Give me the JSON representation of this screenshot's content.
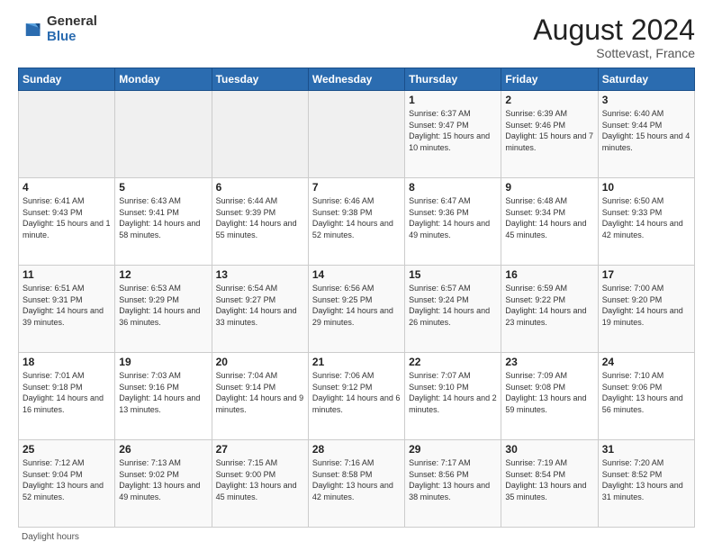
{
  "logo": {
    "general": "General",
    "blue": "Blue"
  },
  "title": "August 2024",
  "location": "Sottevast, France",
  "days_of_week": [
    "Sunday",
    "Monday",
    "Tuesday",
    "Wednesday",
    "Thursday",
    "Friday",
    "Saturday"
  ],
  "footer_text": "Daylight hours",
  "weeks": [
    [
      {
        "day": "",
        "sunrise": "",
        "sunset": "",
        "daylight": ""
      },
      {
        "day": "",
        "sunrise": "",
        "sunset": "",
        "daylight": ""
      },
      {
        "day": "",
        "sunrise": "",
        "sunset": "",
        "daylight": ""
      },
      {
        "day": "",
        "sunrise": "",
        "sunset": "",
        "daylight": ""
      },
      {
        "day": "1",
        "sunrise": "Sunrise: 6:37 AM",
        "sunset": "Sunset: 9:47 PM",
        "daylight": "Daylight: 15 hours and 10 minutes."
      },
      {
        "day": "2",
        "sunrise": "Sunrise: 6:39 AM",
        "sunset": "Sunset: 9:46 PM",
        "daylight": "Daylight: 15 hours and 7 minutes."
      },
      {
        "day": "3",
        "sunrise": "Sunrise: 6:40 AM",
        "sunset": "Sunset: 9:44 PM",
        "daylight": "Daylight: 15 hours and 4 minutes."
      }
    ],
    [
      {
        "day": "4",
        "sunrise": "Sunrise: 6:41 AM",
        "sunset": "Sunset: 9:43 PM",
        "daylight": "Daylight: 15 hours and 1 minute."
      },
      {
        "day": "5",
        "sunrise": "Sunrise: 6:43 AM",
        "sunset": "Sunset: 9:41 PM",
        "daylight": "Daylight: 14 hours and 58 minutes."
      },
      {
        "day": "6",
        "sunrise": "Sunrise: 6:44 AM",
        "sunset": "Sunset: 9:39 PM",
        "daylight": "Daylight: 14 hours and 55 minutes."
      },
      {
        "day": "7",
        "sunrise": "Sunrise: 6:46 AM",
        "sunset": "Sunset: 9:38 PM",
        "daylight": "Daylight: 14 hours and 52 minutes."
      },
      {
        "day": "8",
        "sunrise": "Sunrise: 6:47 AM",
        "sunset": "Sunset: 9:36 PM",
        "daylight": "Daylight: 14 hours and 49 minutes."
      },
      {
        "day": "9",
        "sunrise": "Sunrise: 6:48 AM",
        "sunset": "Sunset: 9:34 PM",
        "daylight": "Daylight: 14 hours and 45 minutes."
      },
      {
        "day": "10",
        "sunrise": "Sunrise: 6:50 AM",
        "sunset": "Sunset: 9:33 PM",
        "daylight": "Daylight: 14 hours and 42 minutes."
      }
    ],
    [
      {
        "day": "11",
        "sunrise": "Sunrise: 6:51 AM",
        "sunset": "Sunset: 9:31 PM",
        "daylight": "Daylight: 14 hours and 39 minutes."
      },
      {
        "day": "12",
        "sunrise": "Sunrise: 6:53 AM",
        "sunset": "Sunset: 9:29 PM",
        "daylight": "Daylight: 14 hours and 36 minutes."
      },
      {
        "day": "13",
        "sunrise": "Sunrise: 6:54 AM",
        "sunset": "Sunset: 9:27 PM",
        "daylight": "Daylight: 14 hours and 33 minutes."
      },
      {
        "day": "14",
        "sunrise": "Sunrise: 6:56 AM",
        "sunset": "Sunset: 9:25 PM",
        "daylight": "Daylight: 14 hours and 29 minutes."
      },
      {
        "day": "15",
        "sunrise": "Sunrise: 6:57 AM",
        "sunset": "Sunset: 9:24 PM",
        "daylight": "Daylight: 14 hours and 26 minutes."
      },
      {
        "day": "16",
        "sunrise": "Sunrise: 6:59 AM",
        "sunset": "Sunset: 9:22 PM",
        "daylight": "Daylight: 14 hours and 23 minutes."
      },
      {
        "day": "17",
        "sunrise": "Sunrise: 7:00 AM",
        "sunset": "Sunset: 9:20 PM",
        "daylight": "Daylight: 14 hours and 19 minutes."
      }
    ],
    [
      {
        "day": "18",
        "sunrise": "Sunrise: 7:01 AM",
        "sunset": "Sunset: 9:18 PM",
        "daylight": "Daylight: 14 hours and 16 minutes."
      },
      {
        "day": "19",
        "sunrise": "Sunrise: 7:03 AM",
        "sunset": "Sunset: 9:16 PM",
        "daylight": "Daylight: 14 hours and 13 minutes."
      },
      {
        "day": "20",
        "sunrise": "Sunrise: 7:04 AM",
        "sunset": "Sunset: 9:14 PM",
        "daylight": "Daylight: 14 hours and 9 minutes."
      },
      {
        "day": "21",
        "sunrise": "Sunrise: 7:06 AM",
        "sunset": "Sunset: 9:12 PM",
        "daylight": "Daylight: 14 hours and 6 minutes."
      },
      {
        "day": "22",
        "sunrise": "Sunrise: 7:07 AM",
        "sunset": "Sunset: 9:10 PM",
        "daylight": "Daylight: 14 hours and 2 minutes."
      },
      {
        "day": "23",
        "sunrise": "Sunrise: 7:09 AM",
        "sunset": "Sunset: 9:08 PM",
        "daylight": "Daylight: 13 hours and 59 minutes."
      },
      {
        "day": "24",
        "sunrise": "Sunrise: 7:10 AM",
        "sunset": "Sunset: 9:06 PM",
        "daylight": "Daylight: 13 hours and 56 minutes."
      }
    ],
    [
      {
        "day": "25",
        "sunrise": "Sunrise: 7:12 AM",
        "sunset": "Sunset: 9:04 PM",
        "daylight": "Daylight: 13 hours and 52 minutes."
      },
      {
        "day": "26",
        "sunrise": "Sunrise: 7:13 AM",
        "sunset": "Sunset: 9:02 PM",
        "daylight": "Daylight: 13 hours and 49 minutes."
      },
      {
        "day": "27",
        "sunrise": "Sunrise: 7:15 AM",
        "sunset": "Sunset: 9:00 PM",
        "daylight": "Daylight: 13 hours and 45 minutes."
      },
      {
        "day": "28",
        "sunrise": "Sunrise: 7:16 AM",
        "sunset": "Sunset: 8:58 PM",
        "daylight": "Daylight: 13 hours and 42 minutes."
      },
      {
        "day": "29",
        "sunrise": "Sunrise: 7:17 AM",
        "sunset": "Sunset: 8:56 PM",
        "daylight": "Daylight: 13 hours and 38 minutes."
      },
      {
        "day": "30",
        "sunrise": "Sunrise: 7:19 AM",
        "sunset": "Sunset: 8:54 PM",
        "daylight": "Daylight: 13 hours and 35 minutes."
      },
      {
        "day": "31",
        "sunrise": "Sunrise: 7:20 AM",
        "sunset": "Sunset: 8:52 PM",
        "daylight": "Daylight: 13 hours and 31 minutes."
      }
    ]
  ]
}
